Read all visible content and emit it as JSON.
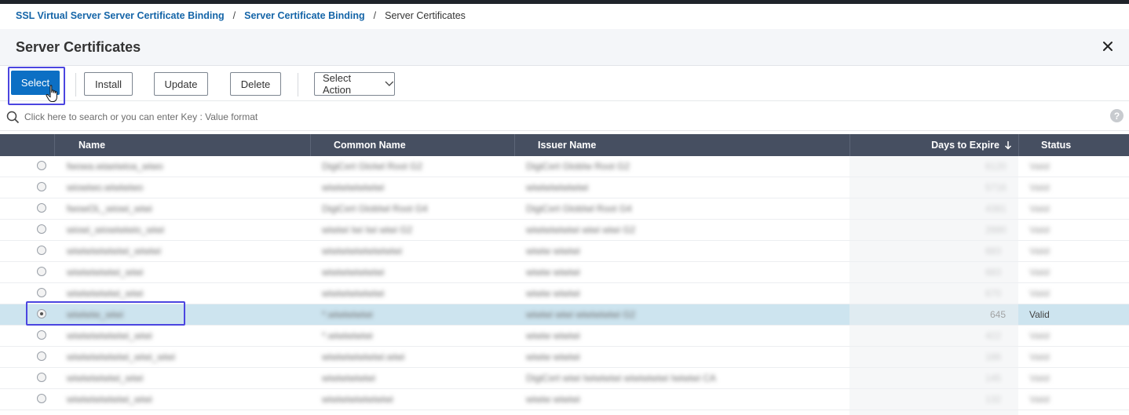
{
  "breadcrumb": {
    "items": [
      "SSL Virtual Server Server Certificate Binding",
      "Server Certificate Binding"
    ],
    "current": "Server Certificates",
    "separator": "/"
  },
  "header": {
    "title": "Server Certificates"
  },
  "toolbar": {
    "select_label": "Select",
    "install_label": "Install",
    "update_label": "Update",
    "delete_label": "Delete",
    "action_label": "Select Action"
  },
  "search": {
    "placeholder": "Click here to search or you can enter Key : Value format"
  },
  "table": {
    "headers": {
      "name": "Name",
      "common_name": "Common Name",
      "issuer_name": "Issuer Name",
      "days_to_expire": "Days to Expire",
      "status": "Status"
    },
    "sort": {
      "column": "days_to_expire",
      "direction": "descending"
    },
    "selected_row": {
      "days": "645",
      "status": "Valid"
    }
  },
  "colors": {
    "accent": "#0c6fc4",
    "header_bg": "#464f61",
    "selected_row": "#cde4ef",
    "highlight_border": "#4b45e0"
  }
}
